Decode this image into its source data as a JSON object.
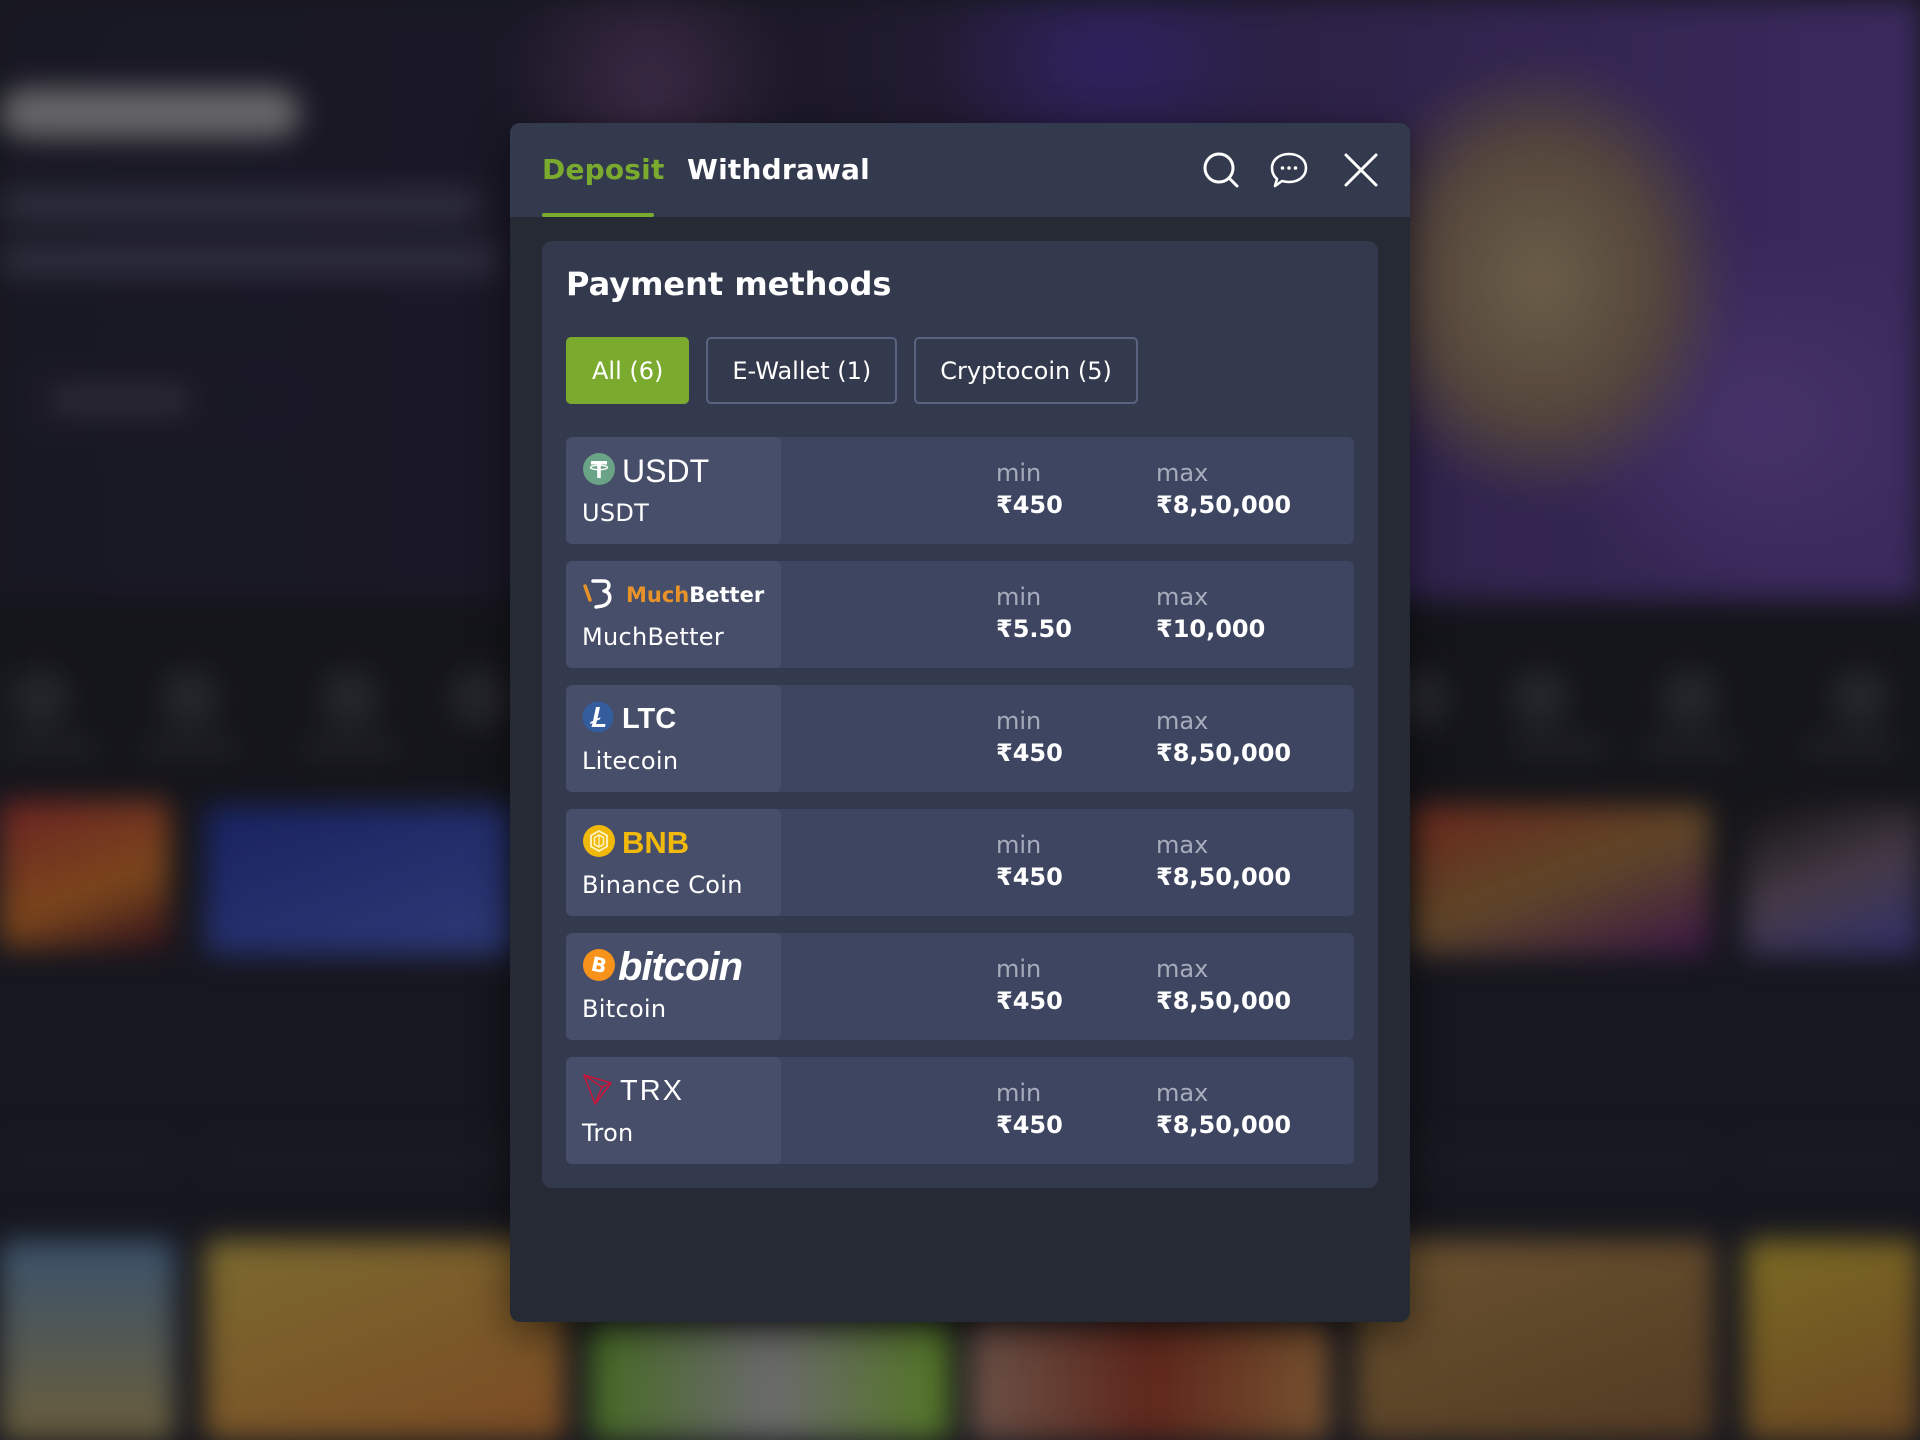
{
  "modal": {
    "tabs": [
      {
        "label": "Deposit",
        "active": true
      },
      {
        "label": "Withdrawal",
        "active": false
      }
    ],
    "header_icons": [
      "search-icon",
      "chat-icon",
      "close-icon"
    ],
    "accent_color": "#7aab2e"
  },
  "payment_methods": {
    "title": "Payment methods",
    "filters": [
      {
        "label": "All (6)",
        "active": true
      },
      {
        "label": "E-Wallet (1)",
        "active": false
      },
      {
        "label": "Cryptocoin (5)",
        "active": false
      }
    ],
    "min_label": "min",
    "max_label": "max",
    "items": [
      {
        "logo_text": "USDT",
        "logo_icon": "tether-icon",
        "logo_color": "#6aa385",
        "name": "USDT",
        "min": "₹450",
        "max": "₹8,50,000"
      },
      {
        "logo_text_a": "Much",
        "logo_text_b": "Better",
        "logo_icon": "muchbetter-icon",
        "logo_color": "#e8922a",
        "name": "MuchBetter",
        "min": "₹5.50",
        "max": "₹10,000"
      },
      {
        "logo_text": "LTC",
        "logo_icon": "litecoin-icon",
        "logo_color": "#345d9d",
        "name": "Litecoin",
        "min": "₹450",
        "max": "₹8,50,000"
      },
      {
        "logo_text": "BNB",
        "logo_icon": "bnb-icon",
        "logo_color": "#f0b90b",
        "name": "Binance Coin",
        "min": "₹450",
        "max": "₹8,50,000"
      },
      {
        "logo_text": "bitcoin",
        "logo_icon": "bitcoin-icon",
        "logo_color": "#f7931a",
        "name": "Bitcoin",
        "min": "₹450",
        "max": "₹8,50,000"
      },
      {
        "logo_text": "TRX",
        "logo_icon": "tron-icon",
        "logo_color": "#c4143a",
        "name": "Tron",
        "min": "₹450",
        "max": "₹8,50,000"
      }
    ]
  }
}
